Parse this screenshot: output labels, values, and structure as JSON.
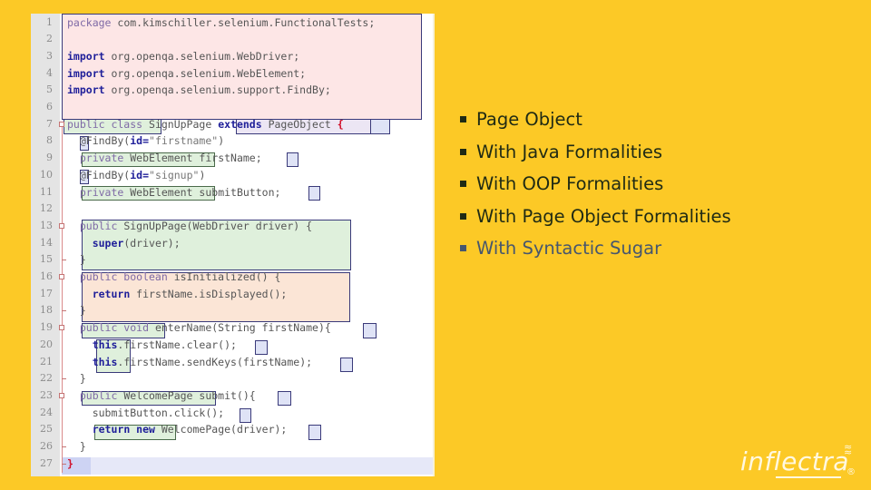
{
  "code": {
    "line_numbers": [
      "1",
      "2",
      "3",
      "4",
      "5",
      "6",
      "7",
      "8",
      "9",
      "10",
      "11",
      "12",
      "13",
      "14",
      "15",
      "16",
      "17",
      "18",
      "19",
      "20",
      "21",
      "22",
      "23",
      "24",
      "25",
      "26",
      "27"
    ],
    "lines": [
      {
        "parts": [
          {
            "t": "package ",
            "c": "mod"
          },
          {
            "t": "com.kimschiller.selenium.FunctionalTests;",
            "c": ""
          }
        ]
      },
      {
        "parts": []
      },
      {
        "parts": [
          {
            "t": "import",
            "c": "kw"
          },
          {
            "t": " org.openqa.selenium.WebDriver;",
            "c": ""
          }
        ]
      },
      {
        "parts": [
          {
            "t": "import",
            "c": "kw"
          },
          {
            "t": " org.openqa.selenium.WebElement;",
            "c": ""
          }
        ]
      },
      {
        "parts": [
          {
            "t": "import",
            "c": "kw"
          },
          {
            "t": " org.openqa.selenium.support.FindBy;",
            "c": ""
          }
        ]
      },
      {
        "parts": []
      },
      {
        "parts": [
          {
            "t": "public class ",
            "c": "mod"
          },
          {
            "t": "SignUpPage ",
            "c": ""
          },
          {
            "t": "extends",
            "c": "kw"
          },
          {
            "t": " PageObject ",
            "c": ""
          },
          {
            "t": "{",
            "c": "red"
          }
        ]
      },
      {
        "parts": [
          {
            "t": "  @FindBy(",
            "c": ""
          },
          {
            "t": "id",
            "c": "kw"
          },
          {
            "t": "=",
            "c": "kw"
          },
          {
            "t": "\"firstname\"",
            "c": "str"
          },
          {
            "t": ")",
            "c": ""
          }
        ]
      },
      {
        "parts": [
          {
            "t": "  private ",
            "c": "mod"
          },
          {
            "t": "WebElement ",
            "c": ""
          },
          {
            "t": "firstName;",
            "c": ""
          }
        ]
      },
      {
        "parts": [
          {
            "t": "  @FindBy(",
            "c": ""
          },
          {
            "t": "id",
            "c": "kw"
          },
          {
            "t": "=",
            "c": "kw"
          },
          {
            "t": "\"signup\"",
            "c": "str"
          },
          {
            "t": ")",
            "c": ""
          }
        ]
      },
      {
        "parts": [
          {
            "t": "  private ",
            "c": "mod"
          },
          {
            "t": "WebElement ",
            "c": ""
          },
          {
            "t": "submitButton;",
            "c": ""
          }
        ]
      },
      {
        "parts": []
      },
      {
        "parts": [
          {
            "t": "  public ",
            "c": "mod"
          },
          {
            "t": "SignUpPage(WebDriver driver) {",
            "c": ""
          }
        ]
      },
      {
        "parts": [
          {
            "t": "    ",
            "c": ""
          },
          {
            "t": "super",
            "c": "kw"
          },
          {
            "t": "(driver);",
            "c": ""
          }
        ]
      },
      {
        "parts": [
          {
            "t": "  }",
            "c": ""
          }
        ]
      },
      {
        "parts": [
          {
            "t": "  public boolean ",
            "c": "mod"
          },
          {
            "t": "isInitialized() {",
            "c": ""
          }
        ]
      },
      {
        "parts": [
          {
            "t": "    ",
            "c": ""
          },
          {
            "t": "return",
            "c": "kw"
          },
          {
            "t": " firstName.isDisplayed();",
            "c": ""
          }
        ]
      },
      {
        "parts": [
          {
            "t": "  }",
            "c": ""
          }
        ]
      },
      {
        "parts": [
          {
            "t": "  public void ",
            "c": "mod"
          },
          {
            "t": "enterName(String firstName){",
            "c": ""
          }
        ]
      },
      {
        "parts": [
          {
            "t": "    ",
            "c": ""
          },
          {
            "t": "this",
            "c": "kw"
          },
          {
            "t": ".firstName.clear();",
            "c": ""
          }
        ]
      },
      {
        "parts": [
          {
            "t": "    ",
            "c": ""
          },
          {
            "t": "this",
            "c": "kw"
          },
          {
            "t": ".firstName.sendKeys(firstName);",
            "c": ""
          }
        ]
      },
      {
        "parts": [
          {
            "t": "  }",
            "c": ""
          }
        ]
      },
      {
        "parts": [
          {
            "t": "  public ",
            "c": "mod"
          },
          {
            "t": "WelcomePage submit(){",
            "c": ""
          }
        ]
      },
      {
        "parts": [
          {
            "t": "    submitButton.click();",
            "c": ""
          }
        ]
      },
      {
        "parts": [
          {
            "t": "    ",
            "c": ""
          },
          {
            "t": "return new",
            "c": "kw"
          },
          {
            "t": " WelcomePage(driver);",
            "c": ""
          }
        ]
      },
      {
        "parts": [
          {
            "t": "  }",
            "c": ""
          }
        ]
      },
      {
        "parts": [
          {
            "t": "}",
            "c": "red"
          }
        ]
      }
    ]
  },
  "bullets": [
    {
      "text": "Page Object",
      "dim": false
    },
    {
      "text": "With Java Formalities",
      "dim": false
    },
    {
      "text": "With OOP Formalities",
      "dim": false
    },
    {
      "text": "With Page Object Formalities",
      "dim": false
    },
    {
      "text": "With Syntactic Sugar",
      "dim": true
    }
  ],
  "logo": {
    "text": "inflectra",
    "registered": "®"
  },
  "colors": {
    "background": "#fcc926",
    "bullet_text": "#1f2a14",
    "bullet_dim": "#46566e",
    "keyword": "#20209a"
  }
}
